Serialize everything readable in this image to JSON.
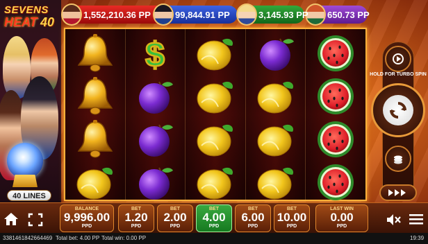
{
  "logo": {
    "line1": "SEVENS",
    "line2": "HEAT",
    "line3": "40"
  },
  "lines_badge": "40 LINES",
  "jackpots": [
    {
      "value": "1,552,210.36 PP",
      "color": "#c81a18"
    },
    {
      "value": "99,844.91 PP",
      "color": "#2a48c6"
    },
    {
      "value": "3,145.93 PP",
      "color": "#22882a"
    },
    {
      "value": "650.73 PP",
      "color": "#7c2fb3"
    }
  ],
  "reels": [
    [
      "bell",
      "bell",
      "bell",
      "lemon"
    ],
    [
      "dollar",
      "plum",
      "plum",
      "plum"
    ],
    [
      "lemon",
      "lemon",
      "lemon",
      "lemon"
    ],
    [
      "plum",
      "lemon",
      "lemon",
      "lemon"
    ],
    [
      "watermelon",
      "watermelon",
      "watermelon",
      "watermelon"
    ]
  ],
  "controls": {
    "turbo_hint": "HOLD FOR TURBO SPIN"
  },
  "bottom": {
    "balance_label": "BALANCE",
    "balance_value": "9,996.00",
    "balance_unit": "PPD",
    "bets": [
      {
        "label": "BET",
        "value": "1.20",
        "unit": "PPD",
        "active": false
      },
      {
        "label": "BET",
        "value": "2.00",
        "unit": "PPD",
        "active": false
      },
      {
        "label": "BET",
        "value": "4.00",
        "unit": "PPD",
        "active": true
      },
      {
        "label": "BET",
        "value": "6.00",
        "unit": "PPD",
        "active": false
      },
      {
        "label": "BET",
        "value": "10.00",
        "unit": "PPD",
        "active": false
      }
    ],
    "last_win_label": "LAST WIN",
    "last_win_value": "0.00",
    "last_win_unit": "PPD"
  },
  "status": {
    "session_id": "3381461842664469",
    "total_bet": "Total bet: 4.00 PP",
    "total_win": "Total win: 0.00 PP",
    "time": "19:39"
  },
  "icons": [
    "home-icon",
    "fullscreen-icon",
    "sound-muted-icon",
    "menu-icon",
    "autoplay-icon",
    "spin-icon",
    "coins-icon",
    "fast-forward-icon"
  ]
}
